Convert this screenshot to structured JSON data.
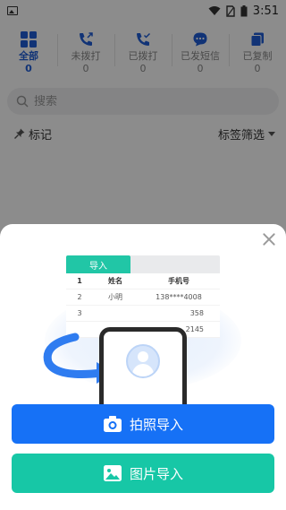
{
  "status_bar": {
    "time": "3:51"
  },
  "tabs": [
    {
      "label": "全部",
      "count": "0",
      "icon": "grid-icon",
      "active": true
    },
    {
      "label": "未拨打",
      "count": "0",
      "icon": "phone-outgoing-icon",
      "active": false
    },
    {
      "label": "已拨打",
      "count": "0",
      "icon": "phone-check-icon",
      "active": false
    },
    {
      "label": "已发短信",
      "count": "0",
      "icon": "message-icon",
      "active": false
    },
    {
      "label": "已复制",
      "count": "0",
      "icon": "copy-icon",
      "active": false
    }
  ],
  "search": {
    "placeholder": "搜索"
  },
  "tag_row": {
    "label": "标记",
    "filter_label": "标签筛选"
  },
  "sheet": {
    "illustration": {
      "tab_label": "导入",
      "columns": [
        "姓名",
        "手机号"
      ],
      "rows": [
        {
          "index": "1",
          "name": "",
          "phone": ""
        },
        {
          "index": "2",
          "name": "小明",
          "phone": "138****4008"
        },
        {
          "index": "3",
          "name": "",
          "phone": "358"
        },
        {
          "index": "",
          "name": "",
          "phone": "2145"
        }
      ]
    },
    "buttons": {
      "camera_import": "拍照导入",
      "photo_import": "图片导入"
    }
  },
  "colors": {
    "accent_blue": "#1671f6",
    "accent_green": "#17c7a6",
    "tab_active": "#1f5ed8"
  }
}
